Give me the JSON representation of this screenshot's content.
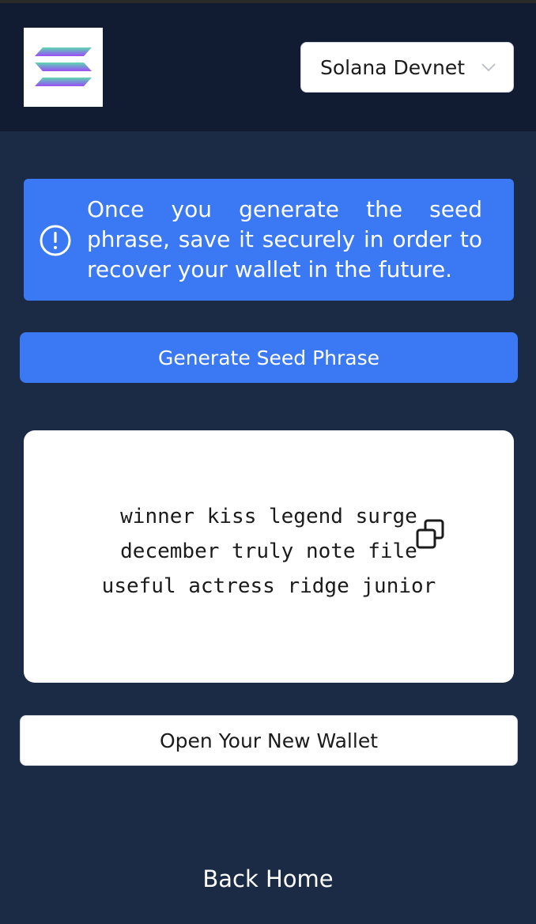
{
  "header": {
    "logo_icon": "solana-logo-icon",
    "network_select": {
      "selected": "Solana Devnet",
      "icon": "chevron-down-icon"
    }
  },
  "info_banner": {
    "icon": "info-circle-icon",
    "message": "Once you generate the seed phrase, save it securely in order to recover your wallet in the future."
  },
  "generate_button": {
    "label": "Generate Seed Phrase"
  },
  "seed_card": {
    "lines": [
      "winner kiss legend surge",
      "december truly note file",
      "useful actress ridge junior"
    ],
    "copy_icon": "copy-icon"
  },
  "open_wallet_button": {
    "label": "Open Your New Wallet"
  },
  "back_home": {
    "label": "Back Home"
  },
  "colors": {
    "background": "#1c2b45",
    "header": "#111c33",
    "accent": "#3b78f4",
    "card": "#ffffff"
  }
}
